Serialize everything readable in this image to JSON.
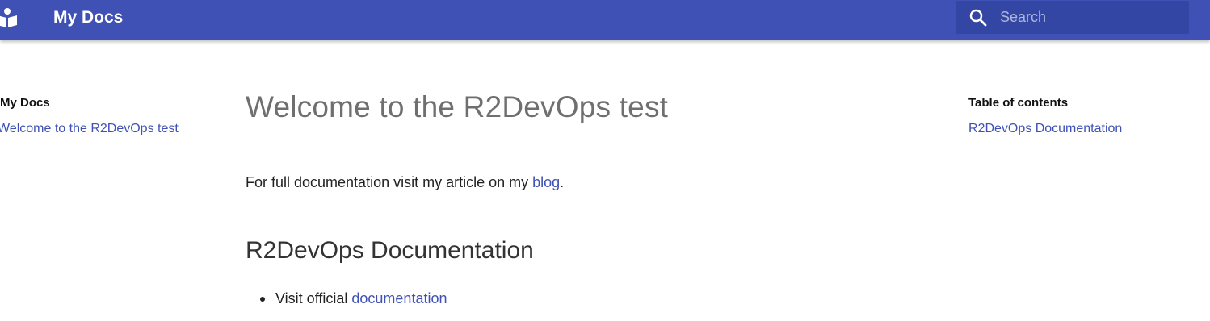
{
  "header": {
    "site_title": "My Docs",
    "search": {
      "placeholder": "Search",
      "value": ""
    },
    "logo_icon": "book-reader-icon",
    "search_icon": "search-icon",
    "color": "#3f51b5"
  },
  "nav": {
    "title": "My Docs",
    "items": [
      {
        "label": "Welcome to the R2DevOps test"
      }
    ]
  },
  "content": {
    "title": "Welcome to the R2DevOps test",
    "paragraph": {
      "prefix": "For full documentation visit my article on my ",
      "link": "blog",
      "suffix": "."
    },
    "section_title": "R2DevOps Documentation",
    "list": [
      {
        "prefix": "Visit official ",
        "link": "documentation"
      }
    ]
  },
  "toc": {
    "title": "Table of contents",
    "items": [
      {
        "label": "R2DevOps Documentation"
      }
    ]
  }
}
